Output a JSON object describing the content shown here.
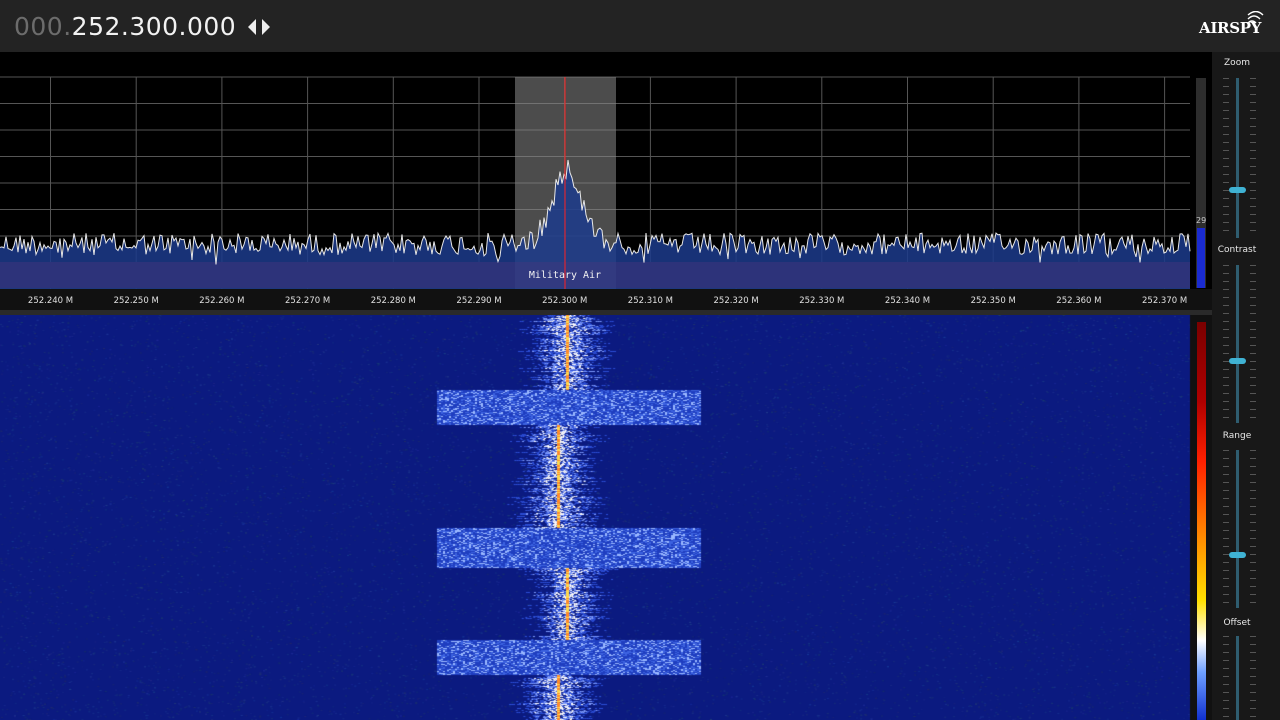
{
  "frequency": {
    "prefix": "000.",
    "main": "252.300.000"
  },
  "logo": {
    "text": "AIRSPY"
  },
  "spectrum": {
    "bookmark_label": "Military Air",
    "axis_labels": [
      "252.240 M",
      "252.250 M",
      "252.260 M",
      "252.270 M",
      "252.280 M",
      "252.290 M",
      "252.300 M",
      "252.310 M",
      "252.320 M",
      "252.330 M",
      "252.340 M",
      "252.350 M",
      "252.360 M",
      "252.370 M"
    ],
    "level_value": "29"
  },
  "controls": {
    "zoom_label": "Zoom",
    "contrast_label": "Contrast",
    "range_label": "Range",
    "offset_label": "Offset"
  },
  "colors": {
    "accent": "#3fb2d3",
    "band_red": "#8a0a18",
    "waterfall_bg": "#0a1a7c",
    "filter_window": "#8a8a8a"
  }
}
